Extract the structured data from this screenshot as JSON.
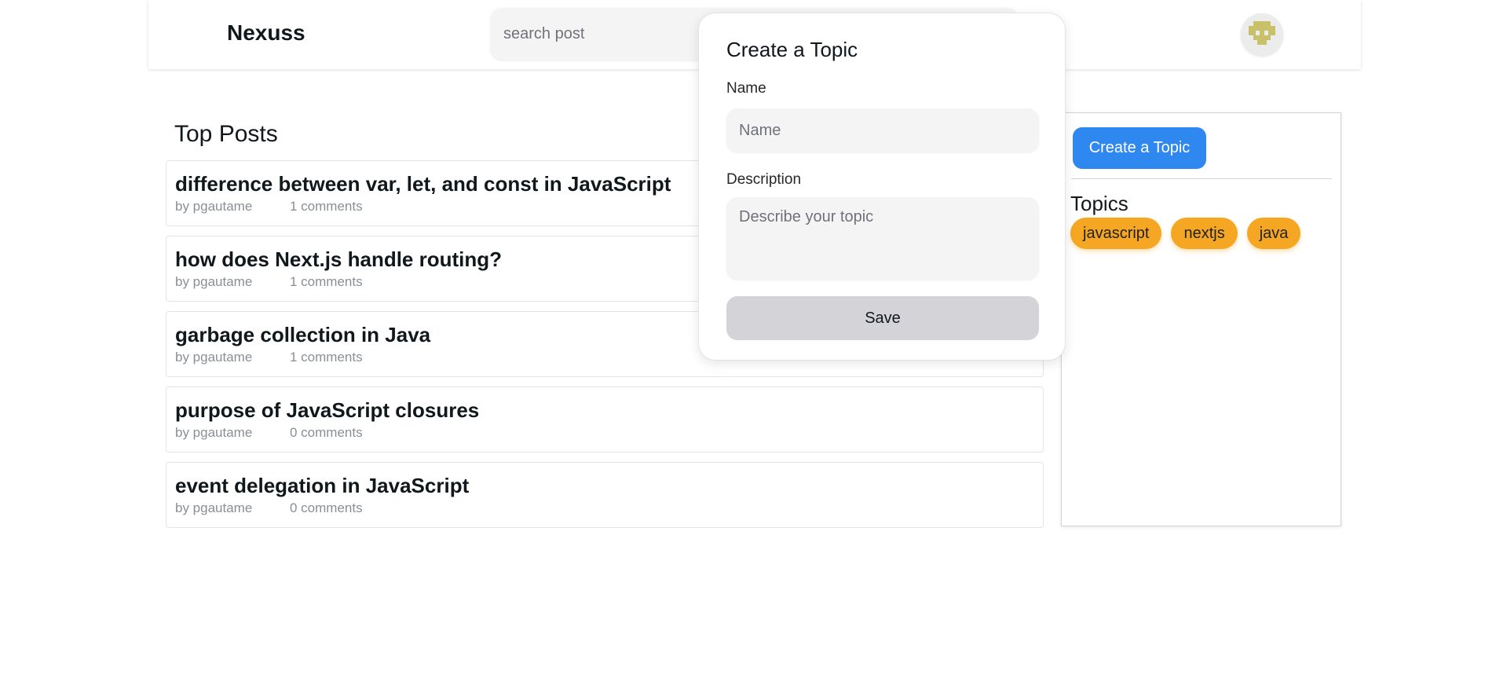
{
  "header": {
    "brand": "Nexuss",
    "search_placeholder": "search post",
    "avatar": "avatar-icon"
  },
  "main": {
    "section_title": "Top Posts",
    "posts": [
      {
        "title": "difference between var, let, and const in JavaScript",
        "author": "by pgautame",
        "comments": "1 comments"
      },
      {
        "title": "how does Next.js handle routing?",
        "author": "by pgautame",
        "comments": "1 comments"
      },
      {
        "title": "garbage collection in Java",
        "author": "by pgautame",
        "comments": "1 comments"
      },
      {
        "title": "purpose of JavaScript closures",
        "author": "by pgautame",
        "comments": "0 comments"
      },
      {
        "title": "event delegation in JavaScript",
        "author": "by pgautame",
        "comments": "0 comments"
      }
    ]
  },
  "sidebar": {
    "create_button": "Create a Topic",
    "topics_title": "Topics",
    "topics": [
      "javascript",
      "nextjs",
      "java"
    ]
  },
  "popover": {
    "title": "Create a Topic",
    "name_label": "Name",
    "name_placeholder": "Name",
    "description_label": "Description",
    "description_placeholder": "Describe your topic",
    "save_label": "Save"
  },
  "colors": {
    "primary": "#2f88f0",
    "topic_chip": "#f5a623",
    "save_button": "#d4d4d8"
  }
}
